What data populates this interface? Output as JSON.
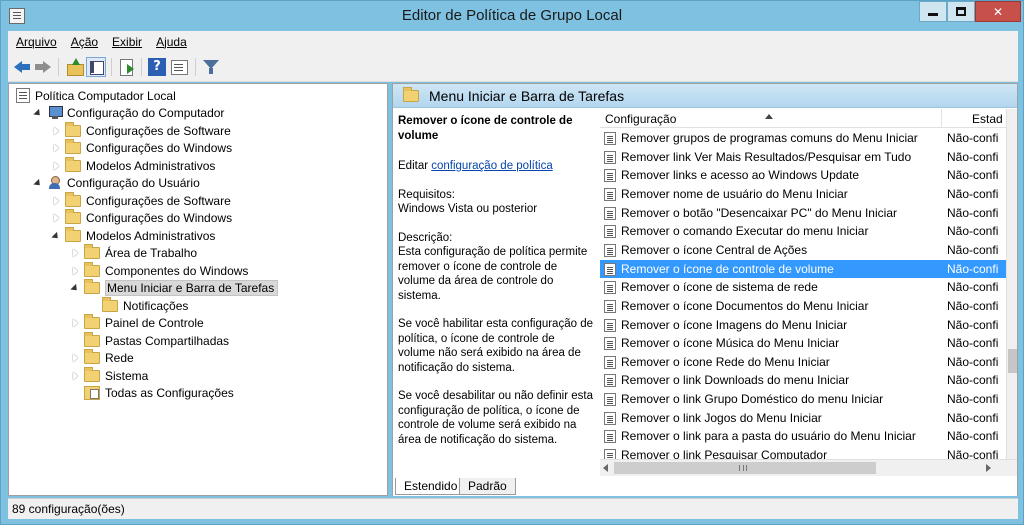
{
  "window": {
    "title": "Editor de Política de Grupo Local"
  },
  "menu": [
    "Arquivo",
    "Ação",
    "Exibir",
    "Ajuda"
  ],
  "toolbar": {
    "help_glyph": "?"
  },
  "tree": [
    {
      "label": "Política Computador Local",
      "depth": 0,
      "icon": "policy-icon",
      "arrow": "none"
    },
    {
      "label": "Configuração do Computador",
      "depth": 1,
      "icon": "computer-icon",
      "arrow": "open"
    },
    {
      "label": "Configurações de Software",
      "depth": 2,
      "icon": "folder-icon",
      "arrow": "closed"
    },
    {
      "label": "Configurações do Windows",
      "depth": 2,
      "icon": "folder-icon",
      "arrow": "closed"
    },
    {
      "label": "Modelos Administrativos",
      "depth": 2,
      "icon": "folder-icon",
      "arrow": "closed"
    },
    {
      "label": "Configuração do Usuário",
      "depth": 1,
      "icon": "user-icon",
      "arrow": "open"
    },
    {
      "label": "Configurações de Software",
      "depth": 2,
      "icon": "folder-icon",
      "arrow": "closed"
    },
    {
      "label": "Configurações do Windows",
      "depth": 2,
      "icon": "folder-icon",
      "arrow": "closed"
    },
    {
      "label": "Modelos Administrativos",
      "depth": 2,
      "icon": "folder-icon",
      "arrow": "open"
    },
    {
      "label": "Área de Trabalho",
      "depth": 3,
      "icon": "folder-icon",
      "arrow": "closed"
    },
    {
      "label": "Componentes do Windows",
      "depth": 3,
      "icon": "folder-icon",
      "arrow": "closed"
    },
    {
      "label": "Menu Iniciar e Barra de Tarefas",
      "depth": 3,
      "icon": "folder-icon",
      "arrow": "open",
      "selected": true
    },
    {
      "label": "Notificações",
      "depth": 4,
      "icon": "folder-icon",
      "arrow": "none"
    },
    {
      "label": "Painel de Controle",
      "depth": 3,
      "icon": "folder-icon",
      "arrow": "closed"
    },
    {
      "label": "Pastas Compartilhadas",
      "depth": 3,
      "icon": "folder-icon",
      "arrow": "none"
    },
    {
      "label": "Rede",
      "depth": 3,
      "icon": "folder-icon",
      "arrow": "closed"
    },
    {
      "label": "Sistema",
      "depth": 3,
      "icon": "folder-icon",
      "arrow": "closed"
    },
    {
      "label": "Todas as Configurações",
      "depth": 3,
      "icon": "all-settings-icon",
      "arrow": "none"
    }
  ],
  "right": {
    "header_title": "Menu Iniciar e Barra de Tarefas",
    "description": {
      "title": "Remover o ícone de controle de volume",
      "edit_prefix": "Editar ",
      "edit_link": "configuração de política",
      "requirements_label": "Requisitos:",
      "requirements": "Windows Vista ou posterior",
      "description_label": "Descrição:",
      "description": "Esta configuração de política permite remover o ícone de controle de volume da área de controle do sistema.",
      "enabled_text": "Se você habilitar esta configuração de política, o ícone de controle de volume não será exibido na área de notificação do sistema.",
      "disabled_text": "Se você desabilitar ou não definir esta configuração de política, o ícone de controle de volume será exibido na área de notificação do sistema."
    },
    "list": {
      "col_setting": "Configuração",
      "col_state": "Estad",
      "rows": [
        {
          "name": "Remover grupos de programas comuns do Menu Iniciar",
          "state": "Não-confi"
        },
        {
          "name": "Remover link Ver Mais Resultados/Pesquisar em Tudo",
          "state": "Não-confi"
        },
        {
          "name": "Remover links e acesso ao Windows Update",
          "state": "Não-confi"
        },
        {
          "name": "Remover nome de usuário do Menu Iniciar",
          "state": "Não-confi"
        },
        {
          "name": "Remover o botão \"Desencaixar PC\" do Menu Iniciar",
          "state": "Não-confi"
        },
        {
          "name": "Remover o comando Executar do menu Iniciar",
          "state": "Não-confi"
        },
        {
          "name": "Remover o ícone Central de Ações",
          "state": "Não-confi"
        },
        {
          "name": "Remover o ícone de controle de volume",
          "state": "Não-confi",
          "selected": true
        },
        {
          "name": "Remover o ícone de sistema de rede",
          "state": "Não-confi"
        },
        {
          "name": "Remover o ícone Documentos do Menu Iniciar",
          "state": "Não-confi"
        },
        {
          "name": "Remover o ícone Imagens do Menu Iniciar",
          "state": "Não-confi"
        },
        {
          "name": "Remover o ícone Música do Menu Iniciar",
          "state": "Não-confi"
        },
        {
          "name": "Remover o ícone Rede do Menu Iniciar",
          "state": "Não-confi"
        },
        {
          "name": "Remover o link Downloads do menu Iniciar",
          "state": "Não-confi"
        },
        {
          "name": "Remover o link Grupo Doméstico do menu Iniciar",
          "state": "Não-confi"
        },
        {
          "name": "Remover o link Jogos do Menu Iniciar",
          "state": "Não-confi"
        },
        {
          "name": "Remover o link para a pasta do usuário do Menu Iniciar",
          "state": "Não-confi"
        },
        {
          "name": "Remover o link Pesquisar Computador",
          "state": "Não-confi"
        }
      ]
    },
    "tabs": [
      "Estendido",
      "Padrão"
    ]
  },
  "status": {
    "text": "89 configuração(ões)"
  }
}
